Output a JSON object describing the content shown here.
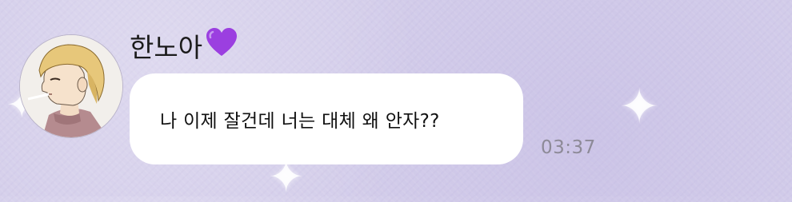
{
  "message": {
    "sender": {
      "name": "한노아",
      "emoji": "💜"
    },
    "text": "나 이제 잘건데 너는 대체 왜 안자??",
    "time": "03:37"
  },
  "colors": {
    "background": "#d3cdea",
    "bubble": "#ffffff",
    "timestamp": "#8d8a97",
    "heart": "#9b3fe0"
  },
  "icons": {
    "heart": "purple-heart-icon",
    "star": "star-icon"
  }
}
